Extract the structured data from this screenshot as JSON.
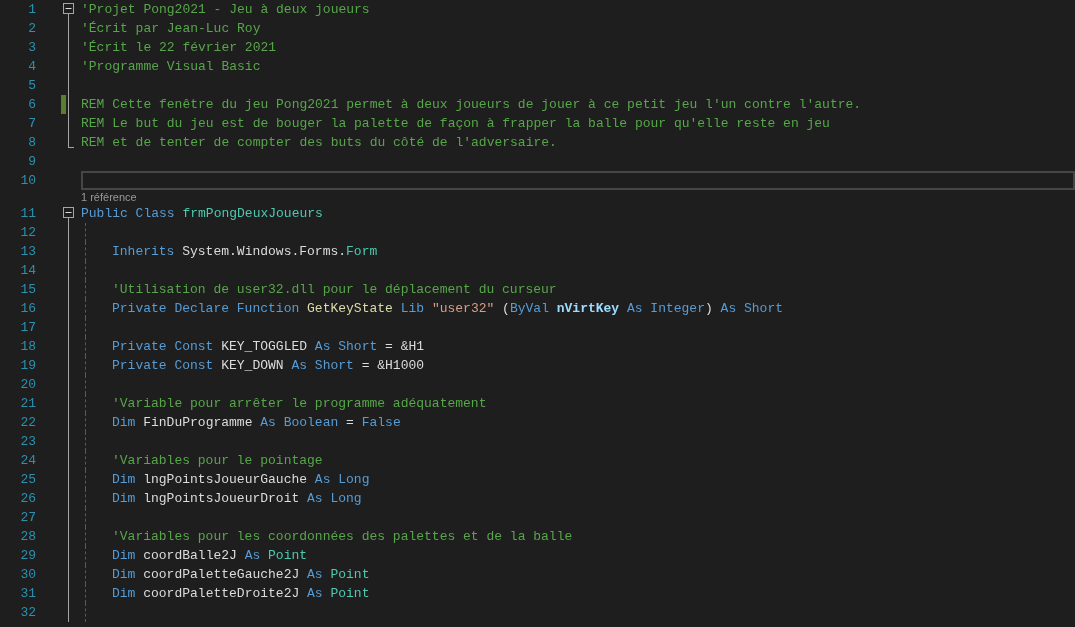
{
  "editor": {
    "lines": [
      {
        "number": "1",
        "kind": "start",
        "expanded": true,
        "tokens": [
          {
            "kind": "comment",
            "text": "'Projet Pong2021 - Jeu à deux joueurs"
          }
        ]
      },
      {
        "number": "2",
        "kind": "inside",
        "tokens": [
          {
            "kind": "comment",
            "text": "'Écrit par Jean-Luc Roy"
          }
        ]
      },
      {
        "number": "3",
        "kind": "inside",
        "tokens": [
          {
            "kind": "comment",
            "text": "'Écrit le 22 février 2021"
          }
        ]
      },
      {
        "number": "4",
        "kind": "inside",
        "tokens": [
          {
            "kind": "comment",
            "text": "'Programme Visual Basic"
          }
        ]
      },
      {
        "number": "5",
        "kind": "inside"
      },
      {
        "number": "6",
        "kind": "inside",
        "changed": true,
        "tokens": [
          {
            "kind": "comment",
            "text": "REM Cette fenêtre du jeu Pong2021 permet à deux joueurs de jouer à ce petit jeu l'un contre l'autre."
          }
        ]
      },
      {
        "number": "7",
        "kind": "inside",
        "tokens": [
          {
            "kind": "comment",
            "text": "REM Le but du jeu est de bouger la palette de façon à frapper la balle pour qu'elle reste en jeu"
          }
        ]
      },
      {
        "number": "8",
        "kind": "end",
        "tokens": [
          {
            "kind": "comment",
            "text": "REM et de tenter de compter des buts du côté de l'adversaire."
          }
        ]
      },
      {
        "number": "9",
        "kind": "plain"
      },
      {
        "number": "10",
        "kind": "plain",
        "current": true
      },
      {
        "number": "11",
        "kind": "start",
        "expanded": true,
        "codelens": "1 référence",
        "tokens": [
          {
            "kind": "keyword",
            "text": "Public Class "
          },
          {
            "kind": "type",
            "text": "frmPongDeuxJoueurs"
          }
        ],
        "children": [
          {
            "number": "12"
          },
          {
            "number": "13",
            "tokens": [
              {
                "kind": "keyword",
                "text": "Inherits "
              },
              {
                "kind": "plain",
                "text": "System.Windows.Forms."
              },
              {
                "kind": "type",
                "text": "Form"
              }
            ]
          },
          {
            "number": "14"
          },
          {
            "number": "15",
            "tokens": [
              {
                "kind": "comment",
                "text": "'Utilisation de user32.dll pour le déplacement du curseur"
              }
            ]
          },
          {
            "number": "16",
            "tokens": [
              {
                "kind": "keyword",
                "text": "Private Declare Function "
              },
              {
                "kind": "method",
                "text": "GetKeyState"
              },
              {
                "kind": "keyword",
                "text": " Lib "
              },
              {
                "kind": "string",
                "text": "\"user32\""
              },
              {
                "kind": "plain",
                "text": " ("
              },
              {
                "kind": "keyword",
                "text": "ByVal "
              },
              {
                "kind": "param",
                "text": "nVirtKey"
              },
              {
                "kind": "keyword",
                "text": " As Integer"
              },
              {
                "kind": "plain",
                "text": ") "
              },
              {
                "kind": "keyword",
                "text": "As Short"
              }
            ]
          },
          {
            "number": "17"
          },
          {
            "number": "18",
            "tokens": [
              {
                "kind": "keyword",
                "text": "Private Const "
              },
              {
                "kind": "ident",
                "text": "KEY_TOGGLED"
              },
              {
                "kind": "keyword",
                "text": " As Short"
              },
              {
                "kind": "plain",
                "text": " = &H1"
              }
            ]
          },
          {
            "number": "19",
            "tokens": [
              {
                "kind": "keyword",
                "text": "Private Const "
              },
              {
                "kind": "ident",
                "text": "KEY_DOWN"
              },
              {
                "kind": "keyword",
                "text": " As Short"
              },
              {
                "kind": "plain",
                "text": " = &H1000"
              }
            ]
          },
          {
            "number": "20"
          },
          {
            "number": "21",
            "tokens": [
              {
                "kind": "comment",
                "text": "'Variable pour arrêter le programme adéquatement"
              }
            ]
          },
          {
            "number": "22",
            "tokens": [
              {
                "kind": "keyword",
                "text": "Dim "
              },
              {
                "kind": "ident",
                "text": "FinDuProgramme"
              },
              {
                "kind": "keyword",
                "text": " As Boolean"
              },
              {
                "kind": "plain",
                "text": " = "
              },
              {
                "kind": "keyword",
                "text": "False"
              }
            ]
          },
          {
            "number": "23"
          },
          {
            "number": "24",
            "tokens": [
              {
                "kind": "comment",
                "text": "'Variables pour le pointage"
              }
            ]
          },
          {
            "number": "25",
            "tokens": [
              {
                "kind": "keyword",
                "text": "Dim "
              },
              {
                "kind": "ident",
                "text": "lngPointsJoueurGauche"
              },
              {
                "kind": "keyword",
                "text": " As Long"
              }
            ]
          },
          {
            "number": "26",
            "tokens": [
              {
                "kind": "keyword",
                "text": "Dim "
              },
              {
                "kind": "ident",
                "text": "lngPointsJoueurDroit"
              },
              {
                "kind": "keyword",
                "text": " As Long"
              }
            ]
          },
          {
            "number": "27"
          },
          {
            "number": "28",
            "tokens": [
              {
                "kind": "comment",
                "text": "'Variables pour les coordonnées des palettes et de la balle"
              }
            ]
          },
          {
            "number": "29",
            "tokens": [
              {
                "kind": "keyword",
                "text": "Dim "
              },
              {
                "kind": "ident",
                "text": "coordBalle2J"
              },
              {
                "kind": "keyword",
                "text": " As "
              },
              {
                "kind": "type",
                "text": "Point"
              }
            ]
          },
          {
            "number": "30",
            "tokens": [
              {
                "kind": "keyword",
                "text": "Dim "
              },
              {
                "kind": "ident",
                "text": "coordPaletteGauche2J"
              },
              {
                "kind": "keyword",
                "text": " As "
              },
              {
                "kind": "type",
                "text": "Point"
              }
            ]
          },
          {
            "number": "31",
            "tokens": [
              {
                "kind": "keyword",
                "text": "Dim "
              },
              {
                "kind": "ident",
                "text": "coordPaletteDroite2J"
              },
              {
                "kind": "keyword",
                "text": " As "
              },
              {
                "kind": "type",
                "text": "Point"
              }
            ]
          },
          {
            "number": "32"
          }
        ]
      }
    ]
  }
}
